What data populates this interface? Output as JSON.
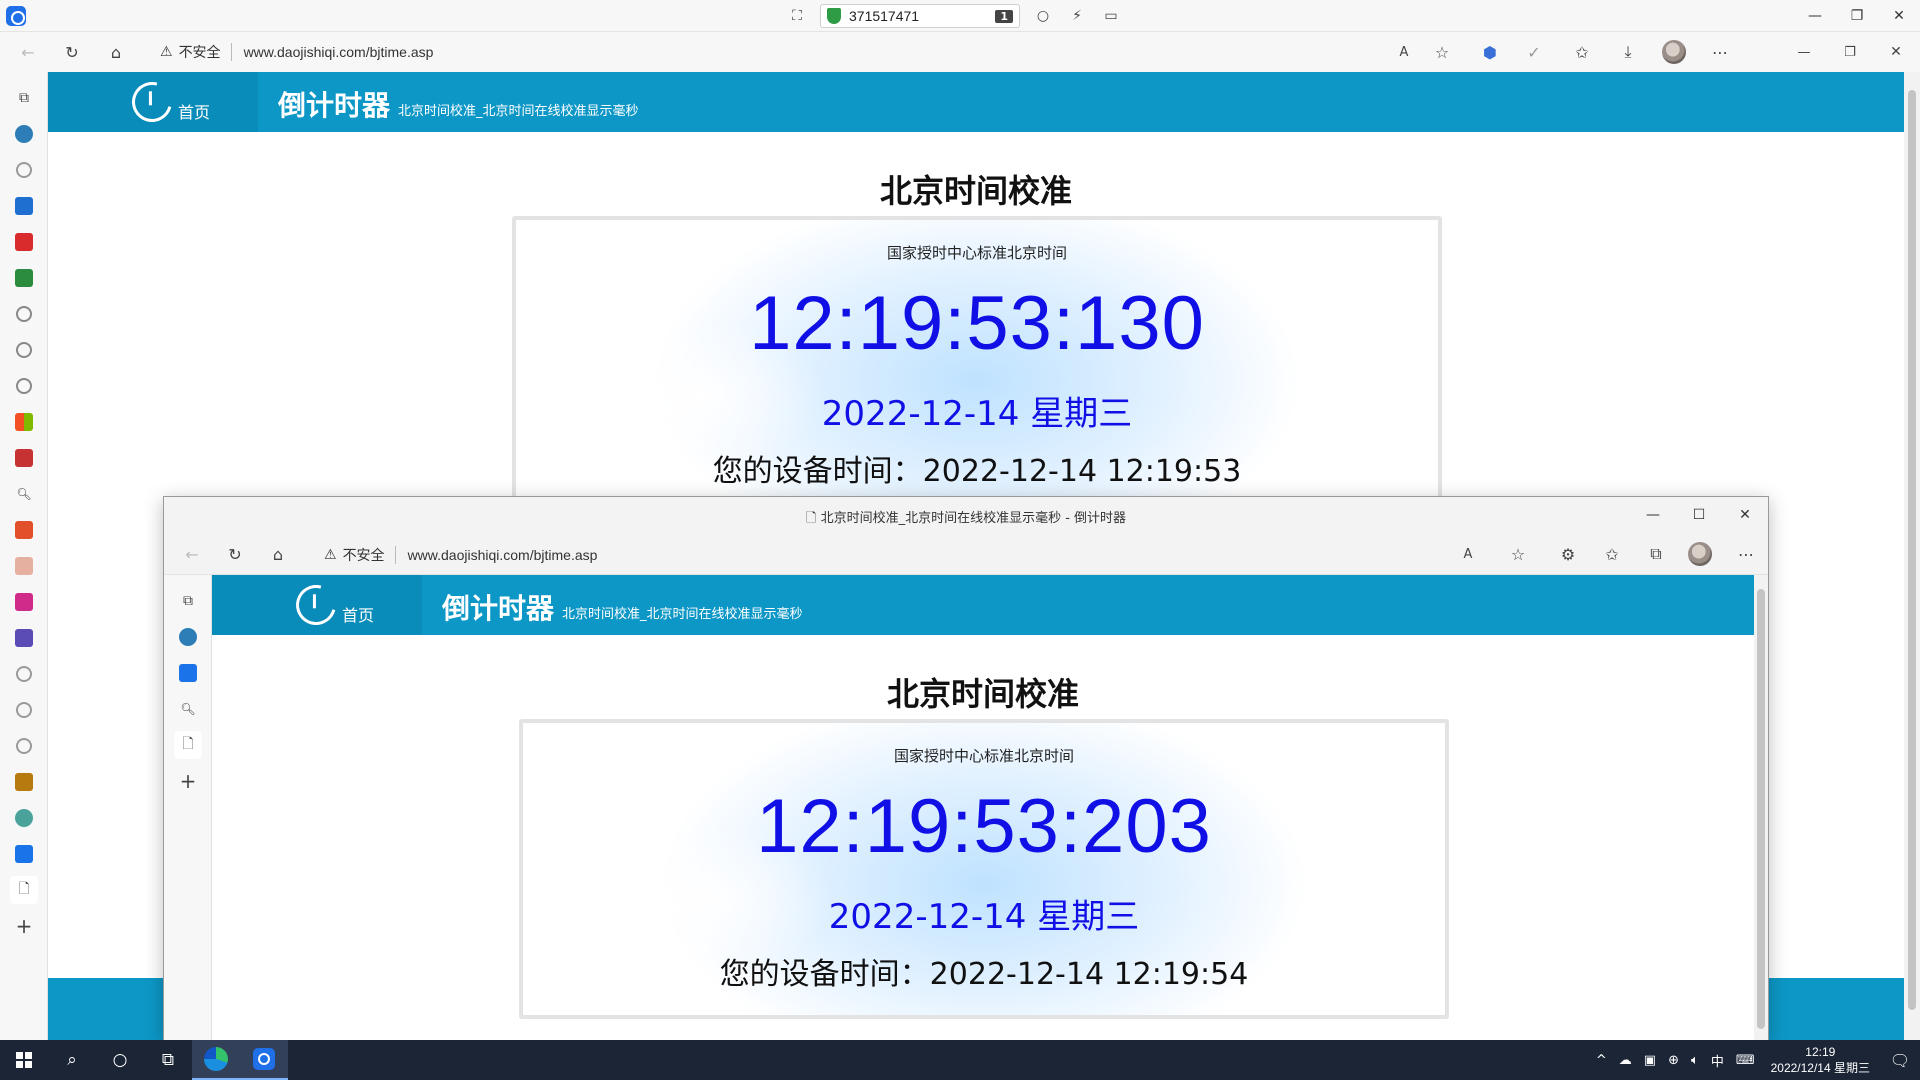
{
  "remote": {
    "id": "371517471",
    "badge": "1"
  },
  "browser": {
    "insecure_label": "不安全",
    "url": "www.daojishiqi.com/bjtime.asp"
  },
  "site": {
    "home_label": "首页",
    "name": "倒计时器",
    "subtitle": "北京时间校准_北京时间在线校准显示毫秒"
  },
  "outer_page": {
    "heading": "北京时间校准",
    "label": "国家授时中心标准北京时间",
    "time": "12:19:53:130",
    "date": "2022-12-14 星期三",
    "device_time": "您的设备时间：2022-12-14 12:19:53"
  },
  "inner_window": {
    "title": "北京时间校准_北京时间在线校准显示毫秒 - 倒计时器",
    "heading": "北京时间校准",
    "label": "国家授时中心标准北京时间",
    "time": "12:19:53:203",
    "date": "2022-12-14 星期三",
    "device_time": "您的设备时间：2022-12-14 12:19:54"
  },
  "taskbar": {
    "time": "12:19",
    "date": "2022/12/14 星期三",
    "ime": "中"
  },
  "colors": {
    "header_blue": "#0d97c6",
    "clock_blue": "#1010e6",
    "taskbar": "#1b2536"
  }
}
